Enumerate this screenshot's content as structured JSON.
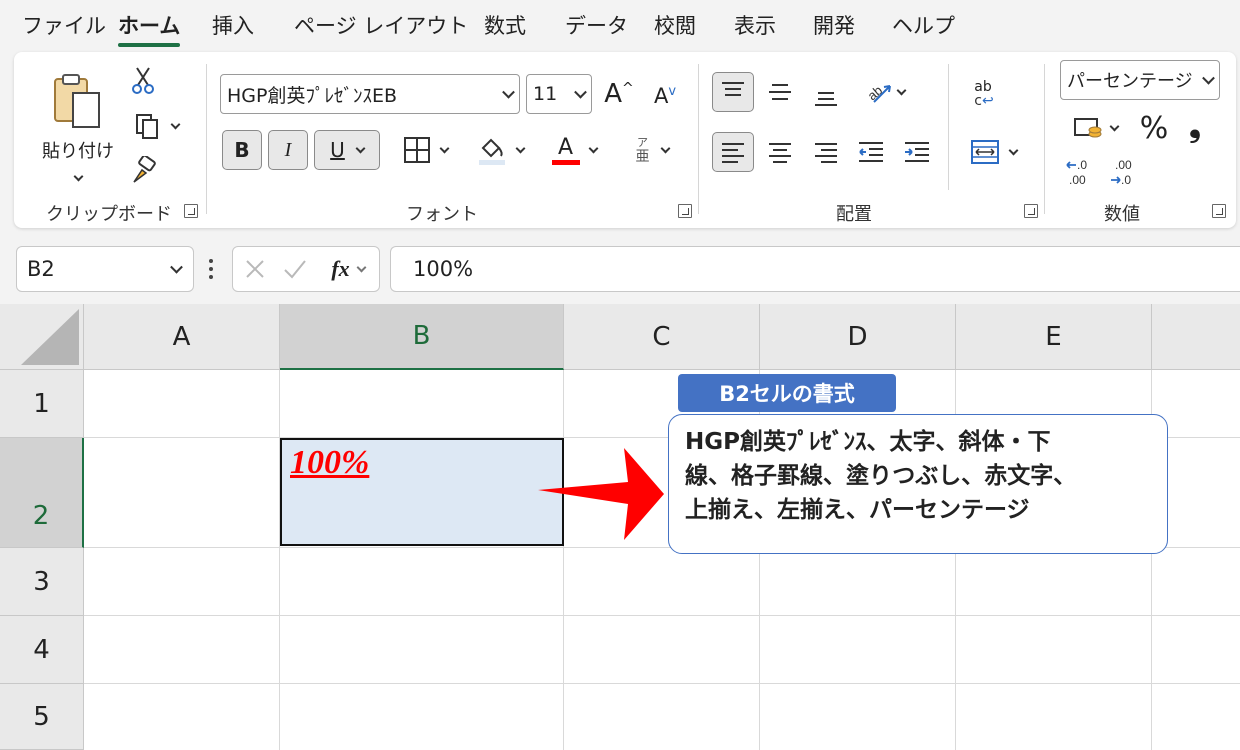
{
  "menu": {
    "tabs": [
      "ファイル",
      "ホーム",
      "挿入",
      "ページ レイアウト",
      "数式",
      "データ",
      "校閲",
      "表示",
      "開発",
      "ヘルプ"
    ],
    "active": "ホーム"
  },
  "ribbon": {
    "clipboard": {
      "paste_label": "貼り付け",
      "group_label": "クリップボード"
    },
    "font": {
      "font_name": "HGP創英ﾌﾟﾚｾﾞﾝｽEB",
      "font_size": "11",
      "bold": "B",
      "italic": "I",
      "underline": "U",
      "font_color_letter": "A",
      "phonetic_top": "ア",
      "phonetic_bottom": "亜",
      "group_label": "フォント"
    },
    "alignment": {
      "group_label": "配置",
      "wrap_top": "ab",
      "wrap_bottom": "c"
    },
    "number": {
      "format": "パーセンテージ",
      "percent": "%",
      "comma": "❟",
      "inc_decimal": "←.0 / .00",
      "dec_decimal": ".00 / →.0",
      "group_label": "数値"
    }
  },
  "formula_bar": {
    "name_box": "B2",
    "fx": "fx",
    "value": "100%"
  },
  "sheet": {
    "columns": [
      "A",
      "B",
      "C",
      "D",
      "E"
    ],
    "rows": [
      "1",
      "2",
      "3",
      "4",
      "5"
    ],
    "selected_column": "B",
    "selected_row": "2",
    "b2_value": "100%"
  },
  "callout": {
    "title": "B2セルの書式",
    "lines": [
      "HGP創英ﾌﾟﾚｾﾞﾝｽ、太字、斜体・下",
      "線、格子罫線、塗りつぶし、赤文字、",
      "上揃え、左揃え、パーセンテージ"
    ]
  },
  "colors": {
    "accent_green": "#1e7145",
    "callout_blue": "#4472c4",
    "font_red": "#ff0000",
    "cell_fill": "#dde8f4",
    "arrow_red": "#ff0000"
  }
}
